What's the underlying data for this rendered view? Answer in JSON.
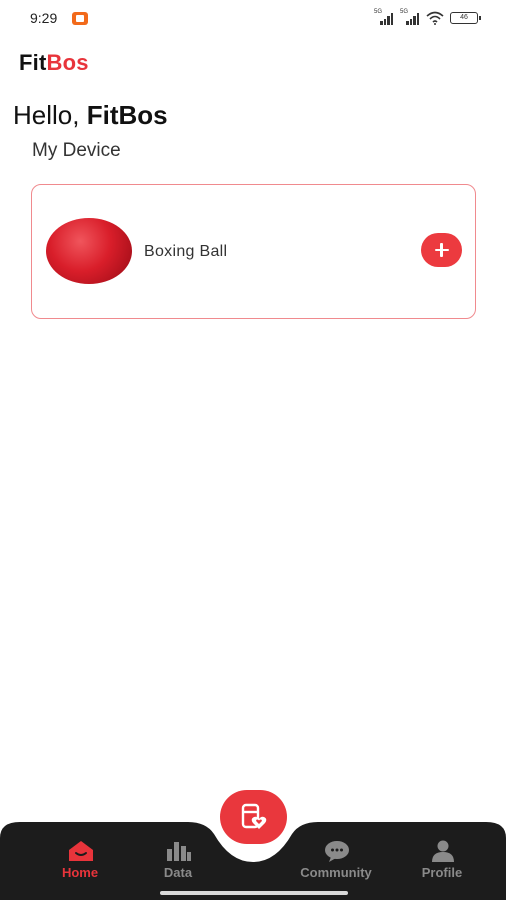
{
  "status_bar": {
    "time": "9:29",
    "signal_1_label": "5G",
    "signal_2_label": "5G",
    "battery": "46"
  },
  "header": {
    "brand_part1": "Fit",
    "brand_part2": "Bos",
    "greeting_prefix": "Hello,",
    "user_name": "FitBos",
    "section_title": "My Device"
  },
  "devices": [
    {
      "name": "Boxing Ball",
      "icon": "boxing-ball-image",
      "action_icon": "plus-icon"
    }
  ],
  "bottom_nav": {
    "items": [
      {
        "label": "Home",
        "icon": "home-icon",
        "active": true
      },
      {
        "label": "Data",
        "icon": "bar-chart-icon",
        "active": false
      },
      {
        "label": "Community",
        "icon": "chat-bubble-icon",
        "active": false
      },
      {
        "label": "Profile",
        "icon": "person-icon",
        "active": false
      }
    ],
    "center_icon": "workout-heart-icon"
  },
  "colors": {
    "accent": "#e8343b",
    "nav_background": "#1c1c1c",
    "inactive": "#8a8a8a",
    "card_border": "#f08a8e"
  }
}
